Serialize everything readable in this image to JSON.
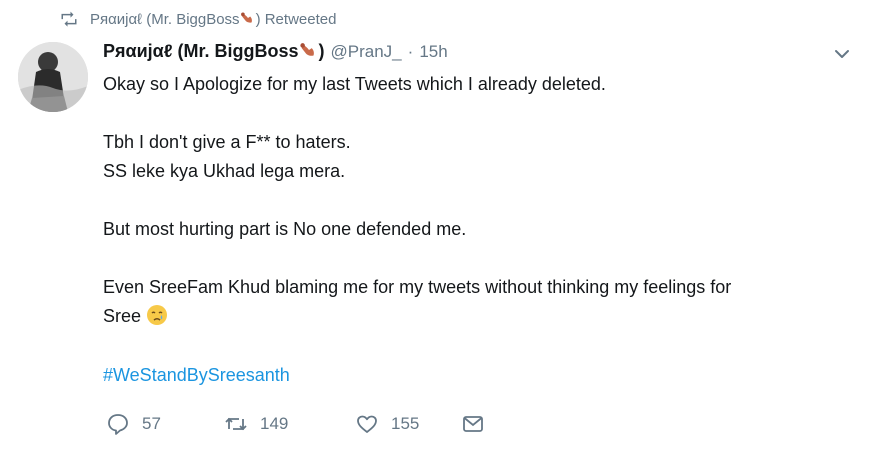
{
  "retweet_bar": {
    "user": "Pяαиjαℓ (Mr. BiggBoss",
    "suffix": ") Retweeted"
  },
  "tweet": {
    "display_name": "Pяαиjαℓ (Mr. BiggBoss",
    "display_name_suffix": ")",
    "handle": "@PranJ_",
    "dot": "·",
    "time": "15h",
    "lines": {
      "l1": "Okay so I Apologize for my last Tweets which I already deleted.",
      "l2": "Tbh I don't give a F** to haters.",
      "l3": "SS leke kya Ukhad lega mera.",
      "l4": "But most hurting part is No one defended me.",
      "l5": "Even SreeFam Khud blaming me for my tweets without thinking my feelings for",
      "l6": "Sree"
    },
    "hashtag": "#WeStandBySreesanth"
  },
  "actions": {
    "reply_count": "57",
    "retweet_count": "149",
    "like_count": "155"
  },
  "icons": {
    "retweet": "retweet-icon",
    "reply": "reply-icon",
    "like": "heart-icon",
    "dm": "envelope-icon",
    "menu": "chevron-down-icon",
    "name_emoji": "arm-emoji",
    "crying": "crying-face-emoji"
  },
  "colors": {
    "link": "#1b95e0",
    "muted": "#657786",
    "text": "#14171a"
  }
}
